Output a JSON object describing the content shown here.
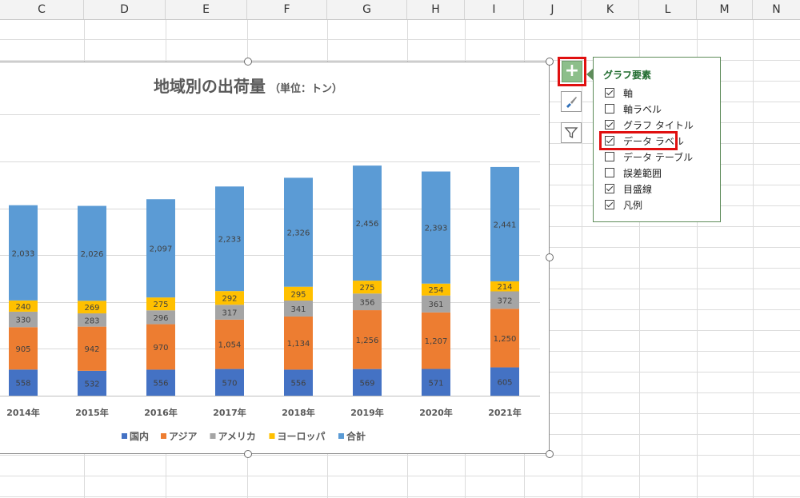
{
  "columns": [
    "C",
    "D",
    "E",
    "F",
    "G",
    "H",
    "I",
    "J",
    "K",
    "L",
    "M",
    "N"
  ],
  "chart": {
    "title": "地域別の出荷量",
    "unit": "（単位：トン）"
  },
  "chart_data": {
    "type": "bar",
    "stacked": true,
    "title": "地域別の出荷量（単位：トン）",
    "categories": [
      "2014年",
      "2015年",
      "2016年",
      "2017年",
      "2018年",
      "2019年",
      "2020年",
      "2021年"
    ],
    "series": [
      {
        "name": "国内",
        "color": "#4472c4",
        "values": [
          558,
          532,
          556,
          570,
          556,
          569,
          571,
          605
        ]
      },
      {
        "name": "アジア",
        "color": "#ed7d31",
        "values": [
          905,
          942,
          970,
          1054,
          1134,
          1256,
          1207,
          1250
        ]
      },
      {
        "name": "アメリカ",
        "color": "#a5a5a5",
        "values": [
          330,
          283,
          296,
          317,
          341,
          356,
          361,
          372
        ]
      },
      {
        "name": "ヨーロッパ",
        "color": "#ffc000",
        "values": [
          240,
          269,
          275,
          292,
          295,
          275,
          254,
          214
        ]
      },
      {
        "name": "合計",
        "color": "#5b9bd5",
        "values": [
          2033,
          2026,
          2097,
          2233,
          2326,
          2456,
          2393,
          2441
        ]
      }
    ],
    "data_labels": [
      [
        "558",
        "532",
        "556",
        "570",
        "556",
        "569",
        "571",
        "605"
      ],
      [
        "905",
        "942",
        "970",
        "1,054",
        "1,134",
        "1,256",
        "1,207",
        "1,250"
      ],
      [
        "330",
        "283",
        "296",
        "317",
        "341",
        "356",
        "361",
        "372"
      ],
      [
        "240",
        "269",
        "275",
        "292",
        "295",
        "275",
        "254",
        "214"
      ],
      [
        "2,033",
        "2,026",
        "2,097",
        "2,233",
        "2,326",
        "2,456",
        "2,393",
        "2,441"
      ]
    ],
    "grid": true,
    "legend_position": "bottom"
  },
  "chart_buttons": {
    "add": "+",
    "style_icon": "brush-icon",
    "filter_icon": "filter-icon"
  },
  "chart_elements_panel": {
    "title": "グラフ要素",
    "options": [
      {
        "label": "軸",
        "checked": true
      },
      {
        "label": "軸ラベル",
        "checked": false
      },
      {
        "label": "グラフ タイトル",
        "checked": true
      },
      {
        "label": "データ ラベル",
        "checked": true
      },
      {
        "label": "データ テーブル",
        "checked": false
      },
      {
        "label": "誤差範囲",
        "checked": false
      },
      {
        "label": "目盛線",
        "checked": true
      },
      {
        "label": "凡例",
        "checked": true
      }
    ]
  },
  "colors": {
    "accent_highlight": "#e01010",
    "panel_title": "#1f6b2e"
  }
}
